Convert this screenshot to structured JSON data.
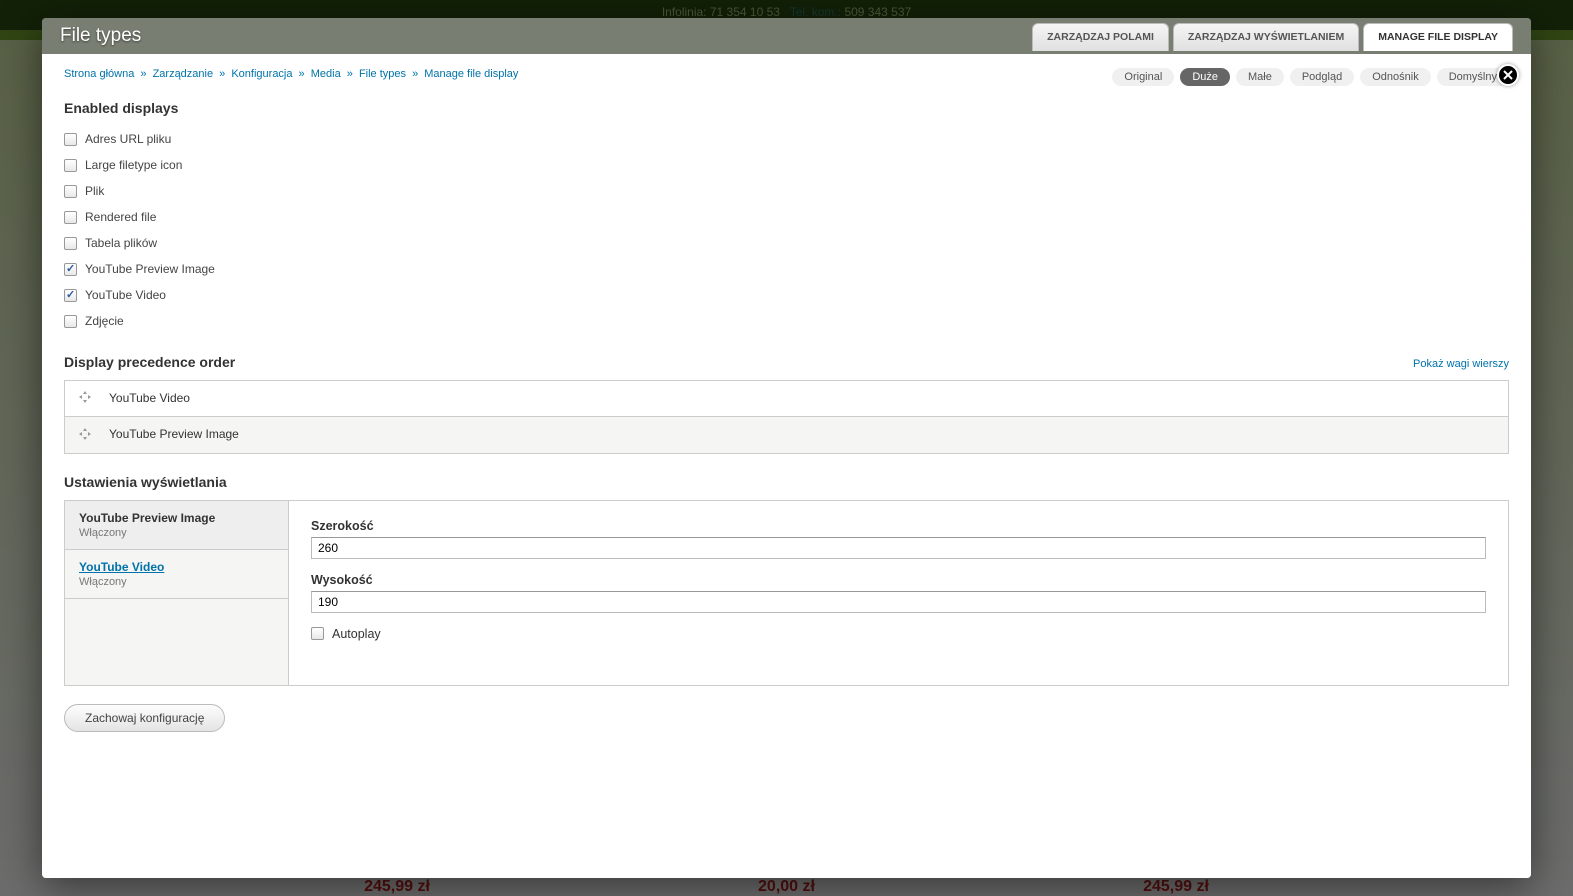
{
  "backdrop": {
    "infoline_label": "Infolinia:",
    "infoline_number": "71 354 10 53",
    "mobile_label": "Tel. kom.:",
    "mobile_number": "509 343 537",
    "price1": "245,99 zł",
    "price2": "20,00 zł",
    "price3": "245,99 zł"
  },
  "modal": {
    "title": "File types",
    "primary_tabs": [
      {
        "label": "Zarządzaj polami",
        "active": false
      },
      {
        "label": "Zarządzaj wyświetlaniem",
        "active": false
      },
      {
        "label": "Manage file display",
        "active": true
      }
    ],
    "secondary_tabs": [
      {
        "label": "Original",
        "active": false
      },
      {
        "label": "Duże",
        "active": true
      },
      {
        "label": "Małe",
        "active": false
      },
      {
        "label": "Podgląd",
        "active": false
      },
      {
        "label": "Odnośnik",
        "active": false
      },
      {
        "label": "Domyślny",
        "active": false
      }
    ]
  },
  "breadcrumb": [
    "Strona główna",
    "Zarządzanie",
    "Konfiguracja",
    "Media",
    "File types",
    "Manage file display"
  ],
  "sections": {
    "enabled_displays": "Enabled displays",
    "precedence": "Display precedence order",
    "settings": "Ustawienia wyświetlania"
  },
  "enabled_displays": [
    {
      "label": "Adres URL pliku",
      "checked": false
    },
    {
      "label": "Large filetype icon",
      "checked": false
    },
    {
      "label": "Plik",
      "checked": false
    },
    {
      "label": "Rendered file",
      "checked": false
    },
    {
      "label": "Tabela plików",
      "checked": false
    },
    {
      "label": "YouTube Preview Image",
      "checked": true
    },
    {
      "label": "YouTube Video",
      "checked": true
    },
    {
      "label": "Zdjęcie",
      "checked": false
    }
  ],
  "show_weights": "Pokaż wagi wierszy",
  "precedence_rows": [
    "YouTube Video",
    "YouTube Preview Image"
  ],
  "vtabs": [
    {
      "title": "YouTube Preview Image",
      "summary": "Włączony",
      "active": true
    },
    {
      "title": "YouTube Video",
      "summary": "Włączony",
      "active": false
    }
  ],
  "settings_panel": {
    "width_label": "Szerokość",
    "width_value": "260",
    "height_label": "Wysokość",
    "height_value": "190",
    "autoplay_label": "Autoplay",
    "autoplay_checked": false
  },
  "submit_label": "Zachowaj konfigurację"
}
